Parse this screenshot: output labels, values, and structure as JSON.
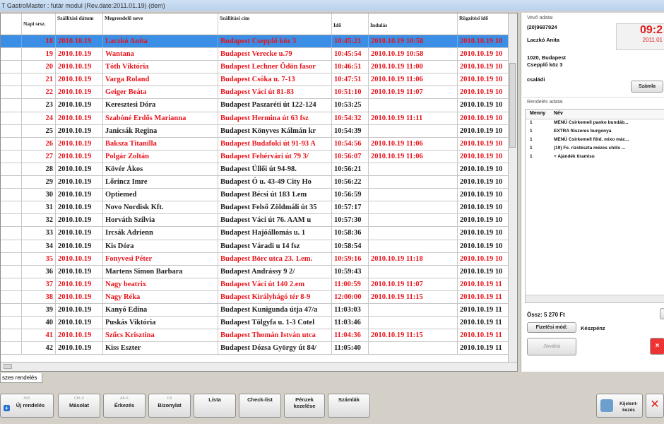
{
  "window": {
    "title": "T GastroMaster : futár modul  (Rev.date:2011.01.19) (dem)"
  },
  "grid": {
    "headers": {
      "num": "Napi srsz.",
      "date": "Szállítási dátum",
      "customer": "Megrendelő neve",
      "address": "Szállítási cím",
      "time": "Idő",
      "depart": "Indulás",
      "rec": "Rögzítési idő"
    },
    "rows": [
      {
        "num": "18",
        "date": "2010.10.19",
        "name": "Laczkó Anita",
        "addr": "Budapest Csepplő köz 3",
        "time": "10:45:21",
        "dep": "2010.10.19 10:58",
        "rec": "2010.10.19 10",
        "color": "sel"
      },
      {
        "num": "19",
        "date": "2010.10.19",
        "name": "Wantana",
        "addr": "Budapest Verecke u.79",
        "time": "10:45:54",
        "dep": "2010.10.19 10:58",
        "rec": "2010.10.19 10",
        "color": "red"
      },
      {
        "num": "20",
        "date": "2010.10.19",
        "name": "Tóth Viktória",
        "addr": "Budapest Lechner Ödön fasor",
        "time": "10:46:51",
        "dep": "2010.10.19 11:00",
        "rec": "2010.10.19 10",
        "color": "red"
      },
      {
        "num": "21",
        "date": "2010.10.19",
        "name": "Varga Roland",
        "addr": "Budapest Csóka u. 7-13",
        "time": "10:47:51",
        "dep": "2010.10.19 11:06",
        "rec": "2010.10.19 10",
        "color": "red"
      },
      {
        "num": "22",
        "date": "2010.10.19",
        "name": "Geiger Beáta",
        "addr": "Budapest Váci út 81-83",
        "time": "10:51:10",
        "dep": "2010.10.19 11:07",
        "rec": "2010.10.19 10",
        "color": "red"
      },
      {
        "num": "23",
        "date": "2010.10.19",
        "name": "Keresztesi Dóra",
        "addr": "Budapest Paszaréti út 122-124",
        "time": "10:53:25",
        "dep": "",
        "rec": "2010.10.19 10",
        "color": "black"
      },
      {
        "num": "24",
        "date": "2010.10.19",
        "name": "Szabóné Erdős Marianna",
        "addr": "Budapest Hermina út 63   fsz",
        "time": "10:54:32",
        "dep": "2010.10.19 11:11",
        "rec": "2010.10.19 10",
        "color": "red"
      },
      {
        "num": "25",
        "date": "2010.10.19",
        "name": "Janicsák Regina",
        "addr": "Budapest Könyves Kálmán kr",
        "time": "10:54:39",
        "dep": "",
        "rec": "2010.10.19 10",
        "color": "black"
      },
      {
        "num": "26",
        "date": "2010.10.19",
        "name": "Baksza Titanilla",
        "addr": "Budapest Budafoki út 91-93 A",
        "time": "10:54:56",
        "dep": "2010.10.19 11:06",
        "rec": "2010.10.19 10",
        "color": "red"
      },
      {
        "num": "27",
        "date": "2010.10.19",
        "name": "Polgár Zoltán",
        "addr": "Budapest Fehérvári út 79   3/",
        "time": "10:56:07",
        "dep": "2010.10.19 11:06",
        "rec": "2010.10.19 10",
        "color": "red"
      },
      {
        "num": "28",
        "date": "2010.10.19",
        "name": "Kövér Ákos",
        "addr": "Budapest Üllői út 94-98.",
        "time": "10:56:21",
        "dep": "",
        "rec": "2010.10.19 10",
        "color": "black"
      },
      {
        "num": "29",
        "date": "2010.10.19",
        "name": "Lőrincz Imre",
        "addr": "Budapest Ó u. 43-49   City Ho",
        "time": "10:56:22",
        "dep": "",
        "rec": "2010.10.19 10",
        "color": "black"
      },
      {
        "num": "30",
        "date": "2010.10.19",
        "name": "Optiemed",
        "addr": "Budapest Bécsi út 183 1.em",
        "time": "10:56:59",
        "dep": "",
        "rec": "2010.10.19 10",
        "color": "black"
      },
      {
        "num": "31",
        "date": "2010.10.19",
        "name": "Novo Nordisk Kft.",
        "addr": "Budapest Felső Zöldmáli út 35",
        "time": "10:57:17",
        "dep": "",
        "rec": "2010.10.19 10",
        "color": "black"
      },
      {
        "num": "32",
        "date": "2010.10.19",
        "name": "Horváth Szilvia",
        "addr": "Budapest Váci út 76.   AAM u",
        "time": "10:57:30",
        "dep": "",
        "rec": "2010.10.19 10",
        "color": "black"
      },
      {
        "num": "33",
        "date": "2010.10.19",
        "name": "Ircsák Adrienn",
        "addr": "Budapest Hajóállomás u. 1",
        "time": "10:58:36",
        "dep": "",
        "rec": "2010.10.19 10",
        "color": "black"
      },
      {
        "num": "34",
        "date": "2010.10.19",
        "name": "Kis Dóra",
        "addr": "Budapest Váradi u 14 fsz",
        "time": "10:58:54",
        "dep": "",
        "rec": "2010.10.19 10",
        "color": "black"
      },
      {
        "num": "35",
        "date": "2010.10.19",
        "name": "Fonyvesi Péter",
        "addr": "Budapest Börc utca 23.   1.em.",
        "time": "10:59:16",
        "dep": "2010.10.19 11:18",
        "rec": "2010.10.19 10",
        "color": "red"
      },
      {
        "num": "36",
        "date": "2010.10.19",
        "name": "Martens Simon Barbara",
        "addr": "Budapest Andrássy 9  2/",
        "time": "10:59:43",
        "dep": "",
        "rec": "2010.10.19 10",
        "color": "black"
      },
      {
        "num": "37",
        "date": "2010.10.19",
        "name": "Nagy beatrix",
        "addr": "Budapest Váci út 140   2.em",
        "time": "11:00:59",
        "dep": "2010.10.19 11:07",
        "rec": "2010.10.19 11",
        "color": "red"
      },
      {
        "num": "38",
        "date": "2010.10.19",
        "name": "Nagy Réka",
        "addr": "Budapest Királyhágó tér 8-9",
        "time": "12:00:00",
        "dep": "2010.10.19 11:15",
        "rec": "2010.10.19 11",
        "color": "red"
      },
      {
        "num": "39",
        "date": "2010.10.19",
        "name": "Kanyó Edina",
        "addr": "Budapest Kunigunda útja 47/a",
        "time": "11:03:03",
        "dep": "",
        "rec": "2010.10.19 11",
        "color": "black"
      },
      {
        "num": "40",
        "date": "2010.10.19",
        "name": "Puskás Viktória",
        "addr": "Budapest Tölgyfa u. 1-3 Cotel",
        "time": "11:03:46",
        "dep": "",
        "rec": "2010.10.19 11",
        "color": "black"
      },
      {
        "num": "41",
        "date": "2010.10.19",
        "name": "Szűcs Krisztina",
        "addr": "Budapest Thomán István utca",
        "time": "11:04:36",
        "dep": "2010.10.19 11:15",
        "rec": "2010.10.19 11",
        "color": "red"
      },
      {
        "num": "42",
        "date": "2010.10.19",
        "name": "Kiss Eszter",
        "addr": "Budapest Dózsa György út 84/",
        "time": "11:05:40",
        "dep": "",
        "rec": "2010.10.19 11",
        "color": "black"
      }
    ]
  },
  "tab": {
    "label": "szes rendelés"
  },
  "right": {
    "customer_section": "Vevő adatai",
    "phone": "(20)9687924",
    "name": "Laczkó Anita",
    "zip_city": "1020, Budapest",
    "street": "Csepplő köz 3",
    "type": "családi",
    "invoice_button": "Számla",
    "clock_time": "09:2",
    "clock_date": "2011.01",
    "order_section": "Rendelés adatai",
    "order_headers": {
      "qty": "Menny",
      "name": "Név"
    },
    "order_items": [
      {
        "qty": "1",
        "name": "MENÜ Csirkemell panko bundáb..."
      },
      {
        "qty": "1",
        "name": "EXTRA fűszeres burgonya"
      },
      {
        "qty": "1",
        "name": "MENÜ Csirkemell föld. mixo mác..."
      },
      {
        "qty": "1",
        "name": "(19) Fe. rizstészta mézes chilis ..."
      },
      {
        "qty": "1",
        "name": "+ Ajándék tiramisu"
      }
    ],
    "total": "Össz:  5 270 Ft",
    "payment_button": "Fizetési mód:",
    "payment_value": "Készpénz",
    "confirm_button": "Jóváhá",
    "close_button": "×"
  },
  "toolbar": {
    "buttons": [
      {
        "key": "INS",
        "label": "Új rendelés"
      },
      {
        "key": "Ctrl-X",
        "label": "Másolat"
      },
      {
        "key": "Alt-X",
        "label": "Érkezés"
      },
      {
        "key": "F8",
        "label": "Bizonylat"
      },
      {
        "key": "",
        "label": "Lista"
      },
      {
        "key": "",
        "label": "Check-list"
      },
      {
        "key": "",
        "label": "Pénzek kezelése"
      },
      {
        "key": "",
        "label": "Számlák"
      }
    ],
    "logout": "Kijelent-kezés"
  }
}
